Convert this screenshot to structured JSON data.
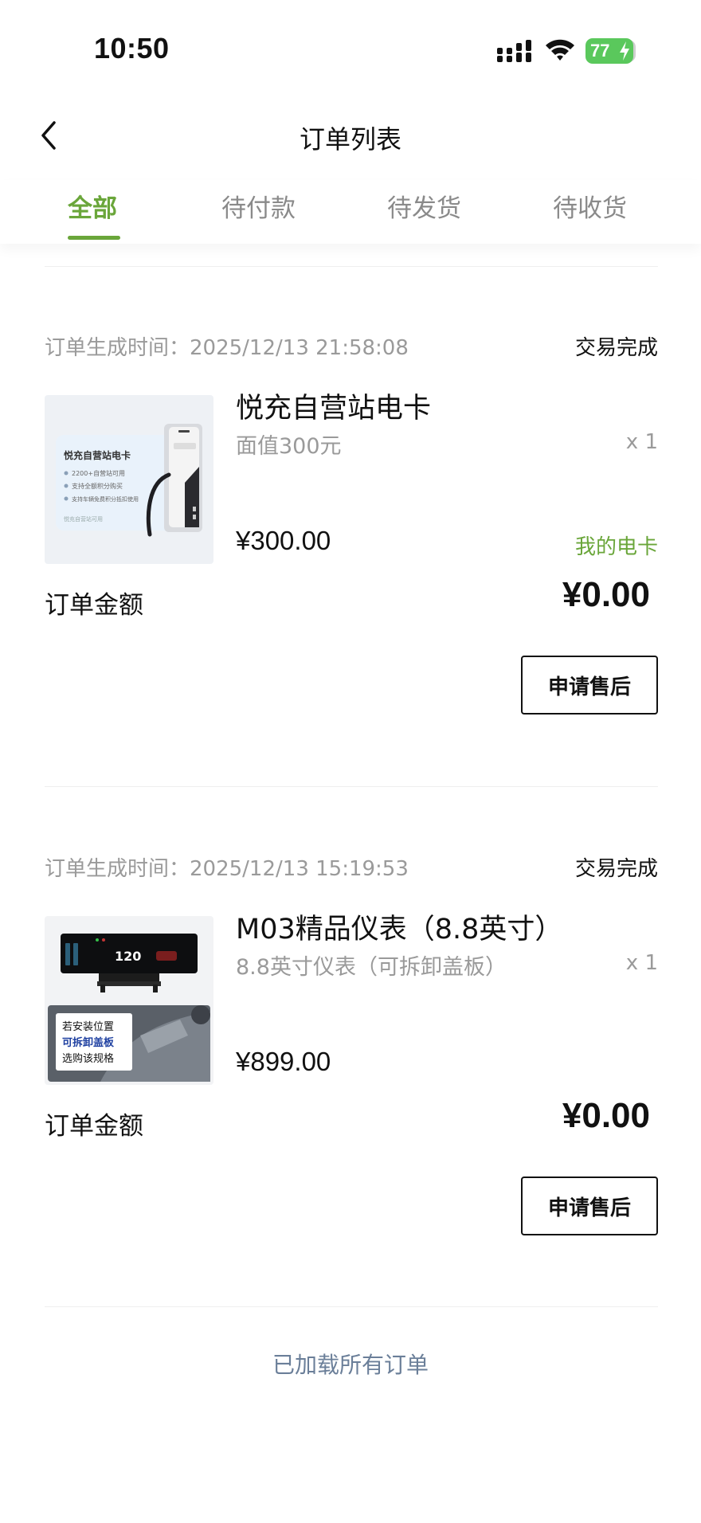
{
  "status_bar": {
    "time": "10:50",
    "battery": "77"
  },
  "nav": {
    "title": "订单列表"
  },
  "tabs": [
    {
      "label": "全部",
      "active": true
    },
    {
      "label": "待付款",
      "active": false
    },
    {
      "label": "待发货",
      "active": false
    },
    {
      "label": "待收货",
      "active": false
    }
  ],
  "orders": [
    {
      "time_label": "订单生成时间：2025/12/13 21:58:08",
      "status": "交易完成",
      "product_name": "悦充自营站电卡",
      "product_spec": "面值300元",
      "quantity": "x 1",
      "price": "¥300.00",
      "link": "我的电卡",
      "total_label": "订单金额",
      "total_value": "¥0.00",
      "after_sale_button": "申请售后",
      "thumb": {
        "title": "悦充自营站电卡",
        "line1": "2200+自营站可用",
        "line2": "支持全额积分购买",
        "line3": "支持车辆免费积分抵扣使用",
        "footer": "悦充自营站可用"
      }
    },
    {
      "time_label": "订单生成时间：2025/12/13 15:19:53",
      "status": "交易完成",
      "product_name": "M03精品仪表（8.8英寸）",
      "product_spec": "8.8英寸仪表（可拆卸盖板）",
      "quantity": "x 1",
      "price": "¥899.00",
      "total_label": "订单金额",
      "total_value": "¥0.00",
      "after_sale_button": "申请售后",
      "thumb": {
        "speed": "120",
        "line1": "若安装位置",
        "line2": "可拆卸盖板",
        "line3": "选购该规格"
      }
    }
  ],
  "footer": {
    "text": "已加载所有订单"
  },
  "colors": {
    "accent": "#6aa63a",
    "battery": "#5ac85c",
    "footer_text": "#6b7f99"
  }
}
